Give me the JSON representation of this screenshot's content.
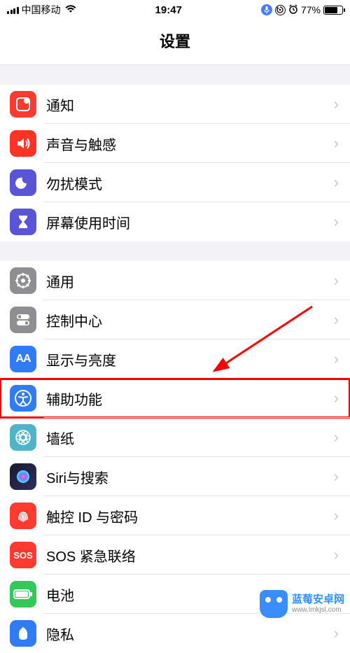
{
  "status": {
    "carrier": "中国移动",
    "time": "19:47",
    "battery_pct": "77%"
  },
  "header": {
    "title": "设置"
  },
  "group1": [
    {
      "id": "notifications",
      "label": "通知",
      "icon": "notif"
    },
    {
      "id": "sounds",
      "label": "声音与触感",
      "icon": "sound"
    },
    {
      "id": "dnd",
      "label": "勿扰模式",
      "icon": "dnd"
    },
    {
      "id": "screentime",
      "label": "屏幕使用时间",
      "icon": "screentime"
    }
  ],
  "group2": [
    {
      "id": "general",
      "label": "通用",
      "icon": "general"
    },
    {
      "id": "controlcenter",
      "label": "控制中心",
      "icon": "control"
    },
    {
      "id": "display",
      "label": "显示与亮度",
      "icon": "display"
    },
    {
      "id": "accessibility",
      "label": "辅助功能",
      "icon": "access",
      "highlighted": true
    },
    {
      "id": "wallpaper",
      "label": "墙纸",
      "icon": "wallpaper"
    },
    {
      "id": "siri",
      "label": "Siri与搜索",
      "icon": "siri"
    },
    {
      "id": "touchid",
      "label": "触控 ID 与密码",
      "icon": "touchid"
    },
    {
      "id": "sos",
      "label": "SOS 紧急联络",
      "icon": "sos"
    },
    {
      "id": "battery",
      "label": "电池",
      "icon": "battery"
    },
    {
      "id": "privacy",
      "label": "隐私",
      "icon": "privacy"
    }
  ],
  "watermark": {
    "brand": "蓝莓安卓网",
    "url": "www.lmkjsl.com"
  }
}
